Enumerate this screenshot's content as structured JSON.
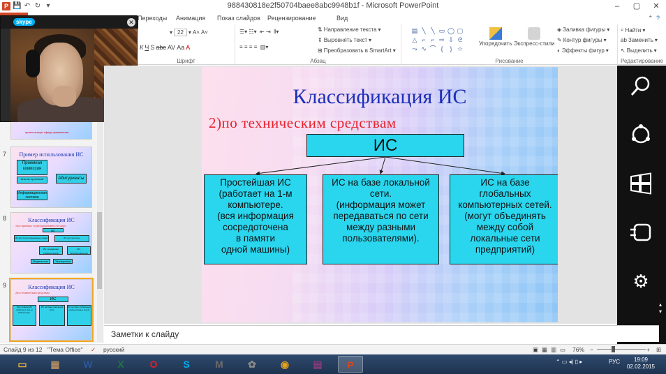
{
  "window": {
    "title": "988430818e2f50704baee8abc9948b1f  -  Microsoft PowerPoint",
    "minimize": "–",
    "restore": "▢",
    "close": "✕",
    "help": "?"
  },
  "tabs": [
    "Переходы",
    "Анимация",
    "Показ слайдов",
    "Рецензирование",
    "Вид"
  ],
  "ribbon": {
    "font_size": "22",
    "groups": {
      "font": "Шрифт",
      "paragraph": "Абзац",
      "drawing": "Рисование",
      "editing": "Редактирование"
    },
    "partial_labels": {
      "vs": "Вс",
      "bu": "Бу"
    },
    "text_direction": "Направление текста",
    "align_text": "Выровнять текст",
    "smartart": "Преобразовать в SmartArt",
    "arrange": "Упорядочить",
    "quick_styles": "Экспресс-стили",
    "shape_fill": "Заливка фигуры",
    "shape_outline": "Контур фигуры",
    "shape_effects": "Эффекты фигур",
    "find": "Найти",
    "replace": "Заменить",
    "select": "Выделить"
  },
  "thumbnails": [
    {
      "num": "6",
      "text": "практическую сферу применения."
    },
    {
      "num": "7",
      "title": "Пример использования ИС",
      "boxes": [
        "Приемная комиссия",
        "Абитуриенты",
        "Анкеты приемной комиссии",
        "Информационная система"
      ]
    },
    {
      "num": "8",
      "title": "Классификация ИС",
      "subtitle": "1)по признаку структурированности задач",
      "boxes": [
        "ИС",
        "ИС для структурированных задач",
        "ИС для частично структурированных задач",
        "ИС, создающие управленческие отчеты",
        "ИС, разрабатывающие альтернативные решения",
        "Модельные",
        "Экспертные"
      ]
    },
    {
      "num": "9",
      "title": "Классификация ИС",
      "subtitle": "2)по техническим средствам",
      "boxes": [
        "ИС",
        "Простейшая ИС (работает на 1-м компьютере.",
        "ИС на базе локальной сети.",
        "ИС на базе глобальных компьютерных сетей."
      ]
    }
  ],
  "skype": {
    "logo": "skype",
    "close": "✕"
  },
  "slide": {
    "title": "Классификация ИС",
    "subtitle": "2)по техническим средствам",
    "root": "ИС",
    "children": [
      [
        "Простейшая ИС",
        "(работает на 1-м",
        "компьютере.",
        "(вся информация",
        "сосредоточена",
        "в памяти",
        " одной машины)"
      ],
      [
        "ИС на базе локальной",
        "сети.",
        "(информация может",
        "передаваться по сети",
        "между разными",
        "пользователями)."
      ],
      [
        "ИС на базе",
        "глобальных",
        "компьютерных сетей.",
        "(могут объединять",
        "между собой",
        "локальные сети",
        "предприятий)"
      ]
    ]
  },
  "notes": {
    "placeholder": "Заметки к слайду"
  },
  "status": {
    "slide": "Слайд 9 из 12",
    "theme": "\"Тема Office\"",
    "lang": "русский",
    "zoom": "76%",
    "zoom_minus": "−",
    "zoom_plus": "+"
  },
  "taskbar": {
    "apps": [
      {
        "id": "explorer",
        "glyph": "▭",
        "color": "#e0b040"
      },
      {
        "id": "app2",
        "glyph": "▦",
        "color": "#b08a60"
      },
      {
        "id": "word",
        "glyph": "W",
        "color": "#2b579a"
      },
      {
        "id": "excel",
        "glyph": "X",
        "color": "#217346"
      },
      {
        "id": "opera",
        "glyph": "O",
        "color": "#e0202a"
      },
      {
        "id": "skype",
        "glyph": "S",
        "color": "#00aff0"
      },
      {
        "id": "mail",
        "glyph": "M",
        "color": "#6a6a6a"
      },
      {
        "id": "media",
        "glyph": "✿",
        "color": "#8a8a8a"
      },
      {
        "id": "chrome",
        "glyph": "◉",
        "color": "#e0a020"
      },
      {
        "id": "winrar",
        "glyph": "▤",
        "color": "#8a3a7a"
      },
      {
        "id": "powerpoint",
        "glyph": "P",
        "color": "#d24726"
      }
    ],
    "lang": "РУС",
    "time": "19:09",
    "date": "02.02.2015"
  },
  "colors": {
    "accent": "#d24726",
    "box": "#2ad6ee",
    "title": "#1c2fb8",
    "subtitle": "#e8202a"
  }
}
